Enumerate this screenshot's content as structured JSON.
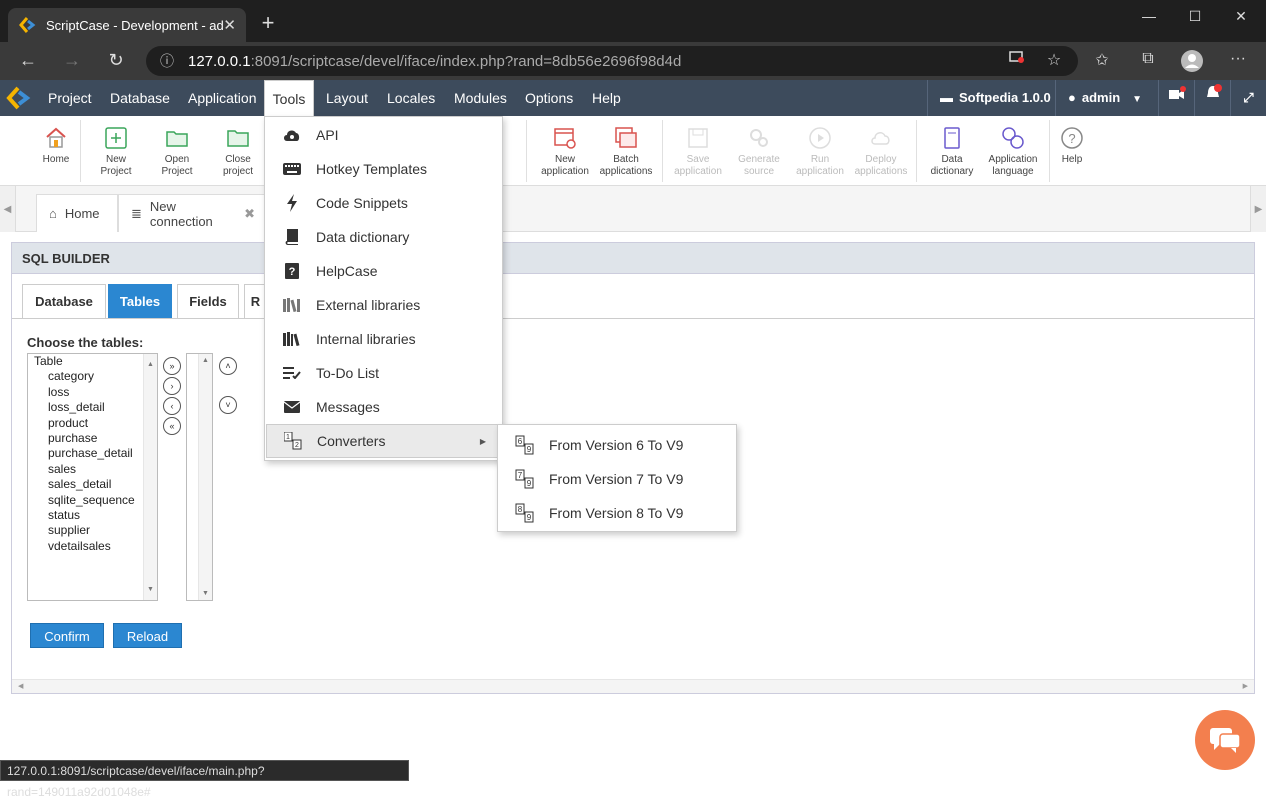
{
  "browser": {
    "tab_title": "ScriptCase - Development - adm",
    "url_host": "127.0.0.1",
    "url_rest": ":8091/scriptcase/devel/iface/index.php?rand=8db56e2696f98d4d",
    "status_url": "127.0.0.1:8091/scriptcase/devel/iface/main.php?rand=149011a92d01048e#"
  },
  "menubar": {
    "items": [
      "Project",
      "Database",
      "Application",
      "Tools",
      "Layout",
      "Locales",
      "Modules",
      "Options",
      "Help"
    ],
    "project_name": "Softpedia 1.0.0",
    "user": "admin"
  },
  "toolbar": {
    "home": "Home",
    "new_project": [
      "New",
      "Project"
    ],
    "open_project": [
      "Open",
      "Project"
    ],
    "close_project": [
      "Close",
      "project"
    ],
    "partial_hidden": "er",
    "new_application": [
      "New",
      "application"
    ],
    "batch_applications": [
      "Batch",
      "applications"
    ],
    "save_application": [
      "Save",
      "application"
    ],
    "generate_source": [
      "Generate",
      "source"
    ],
    "run_application": [
      "Run",
      "application"
    ],
    "deploy_applications": [
      "Deploy",
      "applications"
    ],
    "data_dictionary": [
      "Data",
      "dictionary"
    ],
    "application_language": [
      "Application",
      "language"
    ],
    "help": "Help"
  },
  "app_tabs": {
    "home": "Home",
    "new_connection": "New connection"
  },
  "sql_builder": {
    "title": "SQL BUILDER",
    "tabs": [
      "Database",
      "Tables",
      "Fields",
      "R"
    ],
    "active_tab": "Tables",
    "choose_label": "Choose the tables:",
    "list_header": "Table",
    "tables": [
      "category",
      "loss",
      "loss_detail",
      "product",
      "purchase",
      "purchase_detail",
      "sales",
      "sales_detail",
      "sqlite_sequence",
      "status",
      "supplier",
      "vdetailsales"
    ],
    "confirm": "Confirm",
    "reload": "Reload"
  },
  "tools_menu": {
    "items": [
      "API",
      "Hotkey Templates",
      "Code Snippets",
      "Data dictionary",
      "HelpCase",
      "External libraries",
      "Internal libraries",
      "To-Do List",
      "Messages",
      "Converters"
    ],
    "icons": [
      "cloud-gear-icon",
      "keyboard-icon",
      "bolt-icon",
      "book-icon",
      "help-book-icon",
      "external-libraries-icon",
      "internal-libraries-icon",
      "todo-list-icon",
      "envelope-icon",
      "converters-icon"
    ]
  },
  "converters_submenu": {
    "items": [
      "From Version 6 To V9",
      "From Version 7 To V9",
      "From Version 8 To V9"
    ]
  },
  "colors": {
    "menubar_bg": "#3d4b5c",
    "accent_blue": "#2b87d1",
    "chat_orange": "#f37f4e",
    "browser_dark": "#1f1f1f"
  }
}
